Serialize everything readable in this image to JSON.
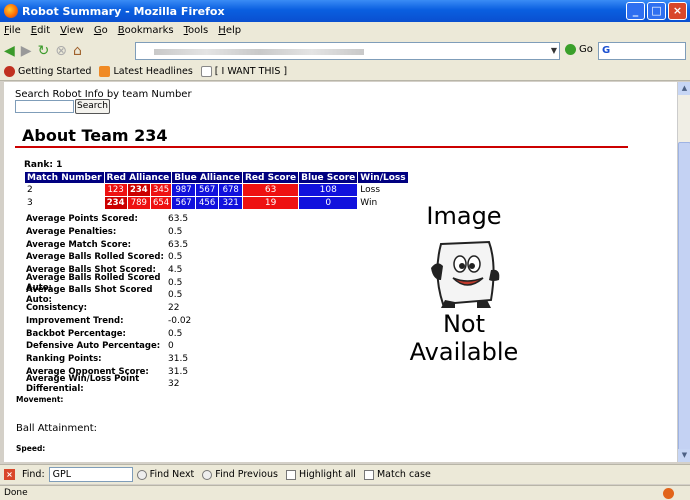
{
  "window": {
    "title": "Robot Summary - Mozilla Firefox",
    "buttons": [
      "_",
      "□",
      "×"
    ]
  },
  "menu": [
    "File",
    "Edit",
    "View",
    "Go",
    "Bookmarks",
    "Tools",
    "Help"
  ],
  "nav": {
    "go_label": "Go",
    "search_value": "G"
  },
  "bookmarks": [
    "Getting Started",
    "Latest Headlines",
    "[ I WANT THIS ]"
  ],
  "page": {
    "search_label": "Search Robot Info by team Number",
    "search_button": "Search",
    "heading": "About Team 234",
    "rank": "Rank: 1",
    "table": {
      "headers": [
        "Match Number",
        "Red Alliance",
        "Blue Alliance",
        "Red Score",
        "Blue Score",
        "Win/Loss"
      ],
      "rows": [
        {
          "match": "2",
          "red": [
            "123",
            "234",
            "345"
          ],
          "blue": [
            "987",
            "567",
            "678"
          ],
          "red_score": "63",
          "blue_score": "108",
          "result": "Loss"
        },
        {
          "match": "3",
          "red": [
            "234",
            "789",
            "654"
          ],
          "blue": [
            "567",
            "456",
            "321"
          ],
          "red_score": "19",
          "blue_score": "0",
          "result": "Win"
        }
      ]
    },
    "stats": [
      {
        "name": "Average Points Scored:",
        "value": "63.5"
      },
      {
        "name": "Average Penalties:",
        "value": "0.5"
      },
      {
        "name": "Average Match Score:",
        "value": "63.5"
      },
      {
        "name": "Average Balls Rolled Scored:",
        "value": "0.5"
      },
      {
        "name": "Average Balls Shot Scored:",
        "value": "4.5"
      },
      {
        "name": "Average Balls Rolled Scored Auto:",
        "value": "0.5"
      },
      {
        "name": "Average Balls Shot Scored Auto:",
        "value": "0.5"
      },
      {
        "name": "Consistency:",
        "value": "22"
      },
      {
        "name": "Improvement Trend:",
        "value": "-0.02"
      },
      {
        "name": "Backbot Percentage:",
        "value": "0.5"
      },
      {
        "name": "Defensive Auto Percentage:",
        "value": "0"
      },
      {
        "name": "Ranking Points:",
        "value": "31.5"
      },
      {
        "name": "Average Opponent Score:",
        "value": "31.5"
      },
      {
        "name": "Average Win/Loss Point Differential:",
        "value": "32"
      }
    ],
    "movement_label": "Movement:",
    "ball_label": "Ball Attainment:",
    "speed_label": "Speed:",
    "image_top": "Image",
    "image_bottom": "Not Available"
  },
  "findbar": {
    "label": "Find:",
    "value": "GPL",
    "next": "Find Next",
    "previous": "Find Previous",
    "highlight": "Highlight all",
    "match_case": "Match case"
  },
  "status": "Done"
}
